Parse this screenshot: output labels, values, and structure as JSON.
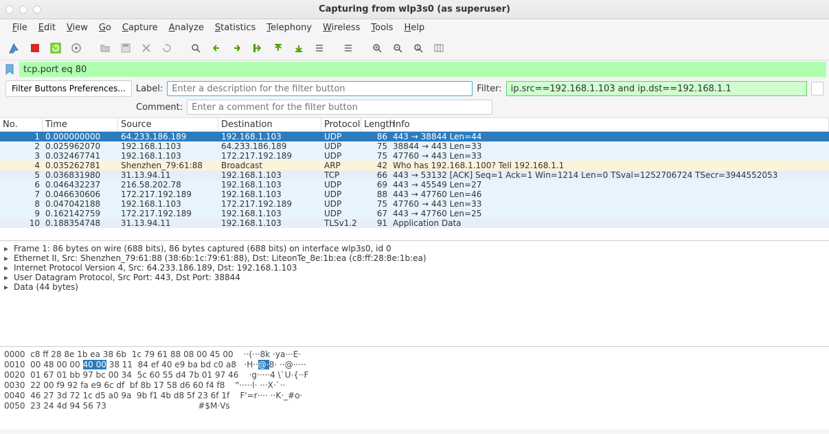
{
  "window": {
    "title": "Capturing from wlp3s0 (as superuser)"
  },
  "menubar": [
    "File",
    "Edit",
    "View",
    "Go",
    "Capture",
    "Analyze",
    "Statistics",
    "Telephony",
    "Wireless",
    "Tools",
    "Help"
  ],
  "filter_main": "tcp.port eq 80",
  "filter_buttons": {
    "prefs_label": "Filter Buttons Preferences...",
    "label_label": "Label:",
    "label_placeholder": "Enter a description for the filter button",
    "filter_label": "Filter:",
    "filter_value": "ip.src==192.168.1.103 and ip.dst==192.168.1.1",
    "comment_label": "Comment:",
    "comment_placeholder": "Enter a comment for the filter button"
  },
  "columns": {
    "no": "No.",
    "time": "Time",
    "source": "Source",
    "dest": "Destination",
    "proto": "Protocol",
    "len": "Length",
    "info": "Info"
  },
  "packets": [
    {
      "no": 1,
      "time": "0.000000000",
      "src": "64.233.186.189",
      "dst": "192.168.1.103",
      "proto": "UDP",
      "len": 86,
      "info": "443 → 38844 Len=44",
      "cls": "selrow"
    },
    {
      "no": 2,
      "time": "0.025962070",
      "src": "192.168.1.103",
      "dst": "64.233.186.189",
      "proto": "UDP",
      "len": 75,
      "info": "38844 → 443 Len=33",
      "cls": "lightblue"
    },
    {
      "no": 3,
      "time": "0.032467741",
      "src": "192.168.1.103",
      "dst": "172.217.192.189",
      "proto": "UDP",
      "len": 75,
      "info": "47760 → 443 Len=33",
      "cls": "lightblue"
    },
    {
      "no": 4,
      "time": "0.035262781",
      "src": "Shenzhen_79:61:88",
      "dst": "Broadcast",
      "proto": "ARP",
      "len": 42,
      "info": "Who has 192.168.1.100? Tell 192.168.1.1",
      "cls": "arp"
    },
    {
      "no": 5,
      "time": "0.036831980",
      "src": "31.13.94.11",
      "dst": "192.168.1.103",
      "proto": "TCP",
      "len": 66,
      "info": "443 → 53132 [ACK] Seq=1 Ack=1 Win=1214 Len=0 TSval=1252706724 TSecr=3944552053",
      "cls": "tcp"
    },
    {
      "no": 6,
      "time": "0.046432237",
      "src": "216.58.202.78",
      "dst": "192.168.1.103",
      "proto": "UDP",
      "len": 69,
      "info": "443 → 45549 Len=27",
      "cls": "lightblue"
    },
    {
      "no": 7,
      "time": "0.046630606",
      "src": "172.217.192.189",
      "dst": "192.168.1.103",
      "proto": "UDP",
      "len": 88,
      "info": "443 → 47760 Len=46",
      "cls": "lightblue"
    },
    {
      "no": 8,
      "time": "0.047042188",
      "src": "192.168.1.103",
      "dst": "172.217.192.189",
      "proto": "UDP",
      "len": 75,
      "info": "47760 → 443 Len=33",
      "cls": "lightblue"
    },
    {
      "no": 9,
      "time": "0.162142759",
      "src": "172.217.192.189",
      "dst": "192.168.1.103",
      "proto": "UDP",
      "len": 67,
      "info": "443 → 47760 Len=25",
      "cls": "lightblue"
    },
    {
      "no": 10,
      "time": "0.188354748",
      "src": "31.13.94.11",
      "dst": "192.168.1.103",
      "proto": "TLSv1.2",
      "len": 91,
      "info": "Application Data",
      "cls": "tcp"
    }
  ],
  "tree": [
    "Frame 1: 86 bytes on wire (688 bits), 86 bytes captured (688 bits) on interface wlp3s0, id 0",
    "Ethernet II, Src: Shenzhen_79:61:88 (38:6b:1c:79:61:88), Dst: LiteonTe_8e:1b:ea (c8:ff:28:8e:1b:ea)",
    "Internet Protocol Version 4, Src: 64.233.186.189, Dst: 192.168.1.103",
    "User Datagram Protocol, Src Port: 443, Dst Port: 38844",
    "Data (44 bytes)"
  ],
  "hex": {
    "lines": [
      {
        "off": "0000",
        "bytes": "c8 ff 28 8e 1b ea 38 6b  1c 79 61 88 08 00 45 00",
        "ascii": "··(···8k ·ya···E·"
      },
      {
        "off": "0010",
        "bytes_a": "00 48 00 00 ",
        "sel": "40 00",
        "bytes_b": " 38 11  84 ef 40 e9 ba bd c0 a8",
        "ascii_a": "·H··",
        "asel": "@·",
        "ascii_b": "8· ··@·····"
      },
      {
        "off": "0020",
        "bytes": "01 67 01 bb 97 bc 00 34  5c 60 55 d4 7b 01 97 46",
        "ascii": "·g·····4 \\`U·{··F"
      },
      {
        "off": "0030",
        "bytes": "22 00 f9 92 fa e9 6c df  bf 8b 17 58 d6 60 f4 f8",
        "ascii": "\"·····l· ···X·`··"
      },
      {
        "off": "0040",
        "bytes": "46 27 3d 72 1c d5 a0 9a  9b f1 4b d8 5f 23 6f 1f",
        "ascii": "F'=r···· ··K·_#o·"
      },
      {
        "off": "0050",
        "bytes": "23 24 4d 94 56 73",
        "ascii": "#$M·Vs"
      }
    ]
  }
}
